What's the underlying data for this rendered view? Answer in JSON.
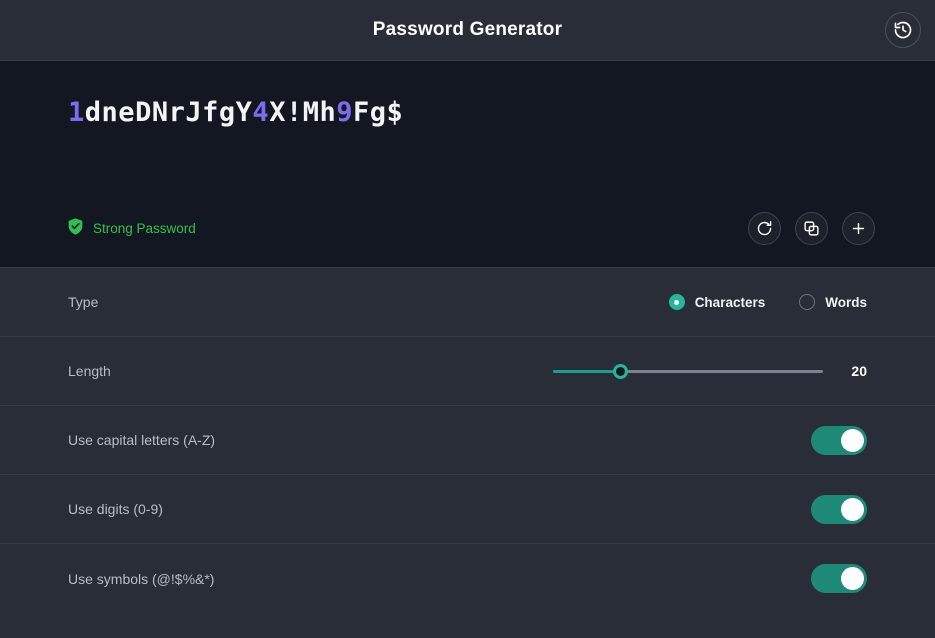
{
  "header": {
    "title": "Password Generator",
    "history_icon": "history-clock-rewind-icon"
  },
  "password_panel": {
    "password": "1dneDNrJfgY4X!Mh9Fg$",
    "password_chars": [
      {
        "c": "1",
        "kind": "digit"
      },
      {
        "c": "d",
        "kind": "letter"
      },
      {
        "c": "n",
        "kind": "letter"
      },
      {
        "c": "e",
        "kind": "letter"
      },
      {
        "c": "D",
        "kind": "letter"
      },
      {
        "c": "N",
        "kind": "letter"
      },
      {
        "c": "r",
        "kind": "letter"
      },
      {
        "c": "J",
        "kind": "letter"
      },
      {
        "c": "f",
        "kind": "letter"
      },
      {
        "c": "g",
        "kind": "letter"
      },
      {
        "c": "Y",
        "kind": "letter"
      },
      {
        "c": "4",
        "kind": "digit"
      },
      {
        "c": "X",
        "kind": "letter"
      },
      {
        "c": "!",
        "kind": "symbol"
      },
      {
        "c": "M",
        "kind": "letter"
      },
      {
        "c": "h",
        "kind": "letter"
      },
      {
        "c": "9",
        "kind": "digit"
      },
      {
        "c": "F",
        "kind": "letter"
      },
      {
        "c": "g",
        "kind": "letter"
      },
      {
        "c": "$",
        "kind": "symbol"
      }
    ],
    "strength_label": "Strong Password",
    "strength_color": "#2fc14f",
    "digit_color": "#7d6bf0",
    "actions": [
      {
        "name": "refresh-icon",
        "label": "Regenerate"
      },
      {
        "name": "copy-icon",
        "label": "Copy"
      },
      {
        "name": "plus-icon",
        "label": "Add"
      }
    ]
  },
  "settings": {
    "type_row": {
      "label": "Type",
      "options": [
        {
          "label": "Characters",
          "selected": true
        },
        {
          "label": "Words",
          "selected": false
        }
      ]
    },
    "length_row": {
      "label": "Length",
      "value": "20",
      "percent": 25
    },
    "toggles": [
      {
        "label": "Use capital letters (A-Z)",
        "on": true
      },
      {
        "label": "Use digits (0-9)",
        "on": true
      },
      {
        "label": "Use symbols (@!$%&*)",
        "on": true
      }
    ]
  },
  "theme": {
    "accent": "#23b79b",
    "header_bg": "#282d38",
    "panel_bg": "#131722"
  }
}
